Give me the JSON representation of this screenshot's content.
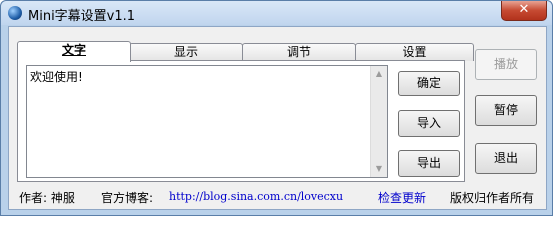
{
  "window": {
    "title": "Mini字幕设置v1.1",
    "close_label": "✕"
  },
  "tabs": [
    {
      "label": "文字",
      "active": true
    },
    {
      "label": "显示",
      "active": false
    },
    {
      "label": "调节",
      "active": false
    },
    {
      "label": "设置",
      "active": false
    }
  ],
  "editor": {
    "text": "欢迎使用!"
  },
  "panel_buttons": {
    "confirm": "确定",
    "import": "导入",
    "export": "导出"
  },
  "side_buttons": {
    "play": "播放",
    "pause": "暂停",
    "quit": "退出"
  },
  "statusbar": {
    "author": "作者: 神服",
    "blog_label": "官方博客:",
    "blog_url": "http://blog.sina.com.cn/lovecxu",
    "check_update": "检查更新",
    "copyright": "版权归作者所有"
  },
  "icons": {
    "app": "app-icon",
    "close": "close-icon",
    "scroll_up": "scroll-up-icon",
    "scroll_down": "scroll-down-icon"
  }
}
